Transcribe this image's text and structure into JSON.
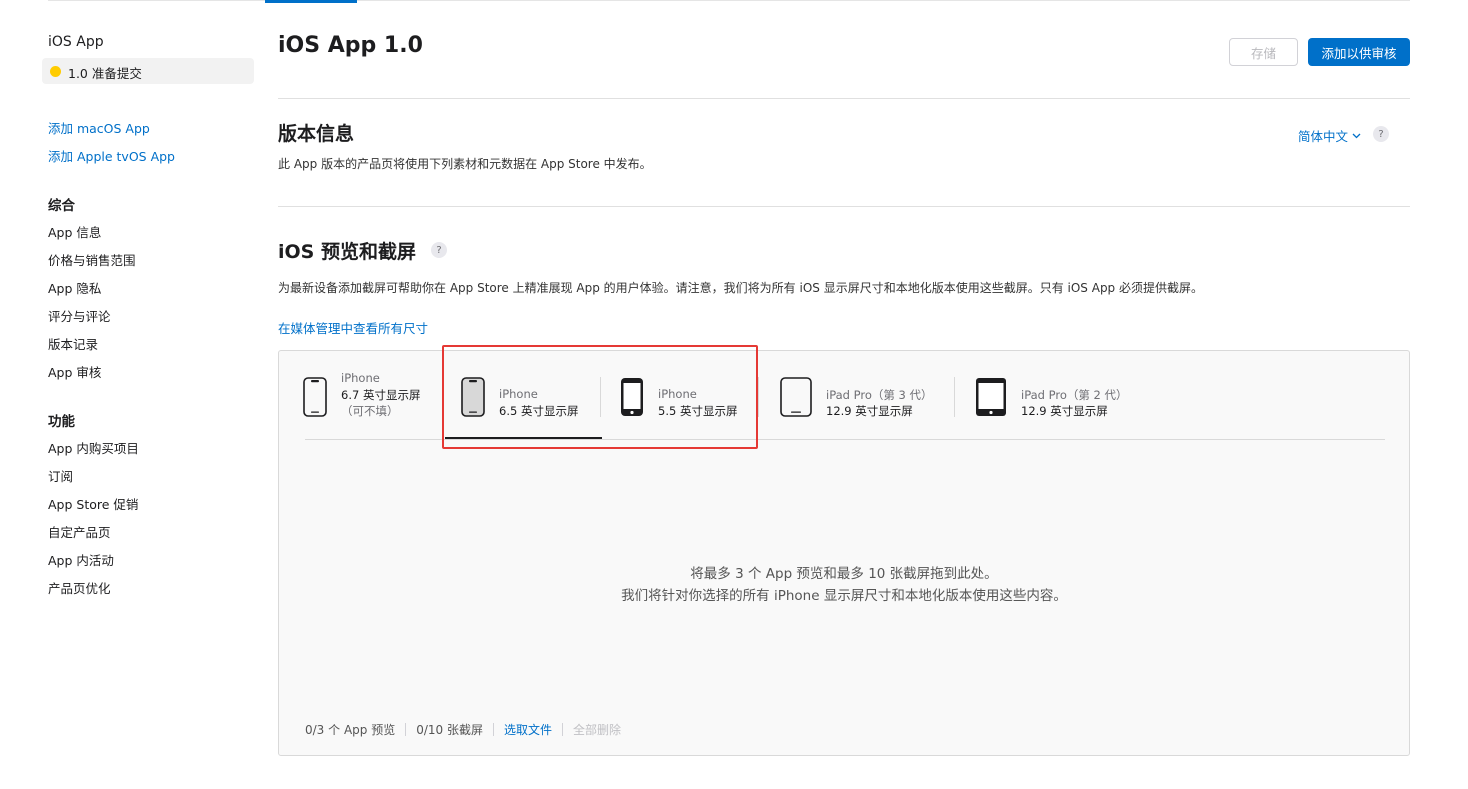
{
  "sidebar": {
    "app_name": "iOS App",
    "version": {
      "label": "1.0 准备提交",
      "status_color": "#ffcc00"
    },
    "add_links": [
      "添加 macOS App",
      "添加 Apple tvOS App"
    ],
    "general_heading": "综合",
    "general_items": [
      "App 信息",
      "价格与销售范围",
      "App 隐私",
      "评分与评论",
      "版本记录",
      "App 审核"
    ],
    "features_heading": "功能",
    "features_items": [
      "App 内购买项目",
      "订阅",
      "App Store 促销",
      "自定产品页",
      "App 内活动",
      "产品页优化"
    ]
  },
  "header": {
    "title": "iOS App 1.0",
    "save_label": "存储",
    "submit_label": "添加以供审核"
  },
  "version_info": {
    "title": "版本信息",
    "description": "此 App 版本的产品页将使用下列素材和元数据在 App Store 中发布。",
    "language": "简体中文",
    "help": "?"
  },
  "previews": {
    "title": "iOS 预览和截屏",
    "help": "?",
    "description": "为最新设备添加截屏可帮助你在 App Store 上精准展现 App 的用户体验。请注意，我们将为所有 iOS 显示屏尺寸和本地化版本使用这些截屏。只有 iOS App 必须提供截屏。",
    "media_link": "在媒体管理中查看所有尺寸",
    "devices": [
      {
        "line1": "iPhone",
        "line2": "6.7 英寸显示屏",
        "line3": "（可不填）",
        "icon": "iphone-notch-icon"
      },
      {
        "line1": "iPhone",
        "line2": "6.5 英寸显示屏",
        "icon": "iphone-notch-icon",
        "active": true
      },
      {
        "line1": "iPhone",
        "line2": "5.5 英寸显示屏",
        "icon": "iphone-home-icon"
      },
      {
        "line1": "iPad Pro（第 3 代）",
        "line2": "12.9 英寸显示屏",
        "icon": "ipad-pro-3-icon"
      },
      {
        "line1": "iPad Pro（第 2 代）",
        "line2": "12.9 英寸显示屏",
        "icon": "ipad-pro-2-icon"
      }
    ],
    "drop_line1": "将最多 3 个 App 预览和最多 10 张截屏拖到此处。",
    "drop_line2": "我们将针对你选择的所有 iPhone 显示屏尺寸和本地化版本使用这些内容。",
    "footer": {
      "preview_count": "0/3 个 App 预览",
      "screenshot_count": "0/10 张截屏",
      "choose_file": "选取文件",
      "delete_all": "全部删除"
    }
  },
  "colors": {
    "accent": "#0070c9",
    "highlight": "#e53935"
  }
}
